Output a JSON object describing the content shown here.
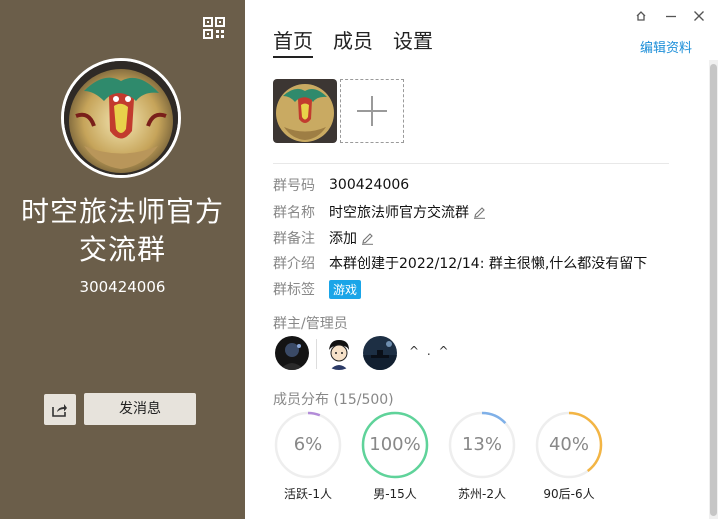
{
  "group": {
    "name_line1": "时空旅法师官方",
    "name_line2": "交流群",
    "id": "300424006"
  },
  "left_buttons": {
    "send_message": "发消息"
  },
  "tabs": [
    {
      "label": "首页",
      "active": true
    },
    {
      "label": "成员",
      "active": false
    },
    {
      "label": "设置",
      "active": false
    }
  ],
  "edit_profile": "编辑资料",
  "info": {
    "group_number": {
      "label": "群号码",
      "value": "300424006"
    },
    "group_name": {
      "label": "群名称",
      "value": "时空旅法师官方交流群"
    },
    "group_remark": {
      "label": "群备注",
      "value": "添加"
    },
    "group_intro": {
      "label": "群介绍",
      "value": "本群创建于2022/12/14:  群主很懒,什么都没有留下"
    },
    "group_tags": {
      "label": "群标签",
      "tags": [
        "游戏"
      ]
    }
  },
  "admins": {
    "title": "群主/管理员",
    "more_text": "^ . ^"
  },
  "distribution": {
    "title": "成员分布 (15/500)",
    "stats": [
      {
        "percent_label": "6%",
        "caption": "活跃-1人",
        "fraction": 0.06,
        "color": "#b38cd9"
      },
      {
        "percent_label": "100%",
        "caption": "男-15人",
        "fraction": 1.0,
        "color": "#5fd39a"
      },
      {
        "percent_label": "13%",
        "caption": "苏州-2人",
        "fraction": 0.13,
        "color": "#7fb0e8"
      },
      {
        "percent_label": "40%",
        "caption": "90后-6人",
        "fraction": 0.4,
        "color": "#f3b544"
      }
    ]
  }
}
